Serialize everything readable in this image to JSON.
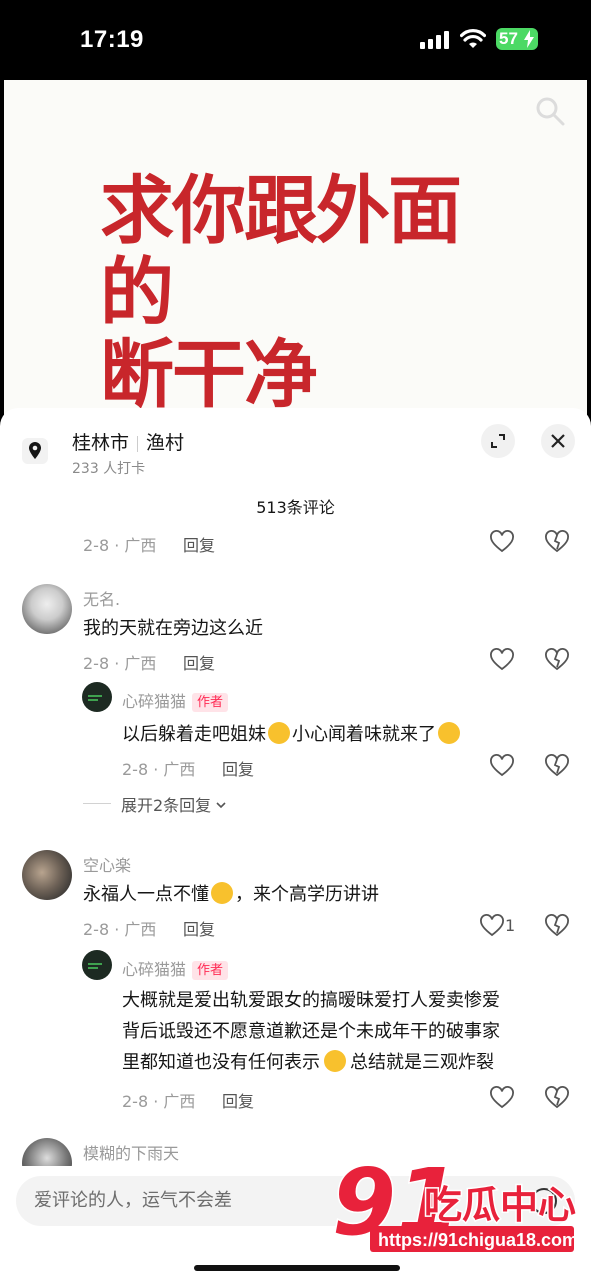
{
  "status": {
    "time": "17:19",
    "battery": "57"
  },
  "video": {
    "title_line1": "求你跟外面的",
    "title_line2": "断干净"
  },
  "location": {
    "city": "桂林市",
    "place": "渔村",
    "checkins": "233 人打卡"
  },
  "comment_count": "513条评论",
  "top_meta": {
    "meta": "2-8 · 广西",
    "reply": "回复"
  },
  "comments": [
    {
      "name": "无名.",
      "text": "我的天就在旁边这么近",
      "meta": "2-8 · 广西",
      "reply": "回复"
    },
    {
      "name": "心碎猫猫",
      "badge": "作者",
      "text_before": "以后躲着走吧姐妹",
      "text_middle": "小心闻着味就来了",
      "meta": "2-8 · 广西",
      "reply": "回复"
    },
    {
      "expand": "展开2条回复"
    },
    {
      "name": "空心楽",
      "text_before": "永福人一点不懂",
      "text_after": "，来个高学历讲讲",
      "meta": "2-8 · 广西",
      "reply": "回复",
      "likes": "1"
    },
    {
      "name": "心碎猫猫",
      "badge": "作者",
      "line1": "大概就是爱出轨爱跟女的搞暧昧爱打人爱卖惨爱",
      "line2": "背后诋毁还不愿意道歉还是个未成年干的破事家",
      "line3_before": "里都知道也没有任何表示",
      "line3_after": "总结就是三观炸裂",
      "meta": "2-8 · 广西",
      "reply": "回复"
    },
    {
      "name": "模糊的下雨天"
    }
  ],
  "input": {
    "placeholder": "爱评论的人，运气不会差"
  },
  "watermark": {
    "logo": "91",
    "text": "吃瓜中心",
    "url": "https://91chigua18.com"
  },
  "colors": {
    "accent_red": "#c8262b",
    "badge": "#ff2c55",
    "battery": "#4cd964"
  }
}
